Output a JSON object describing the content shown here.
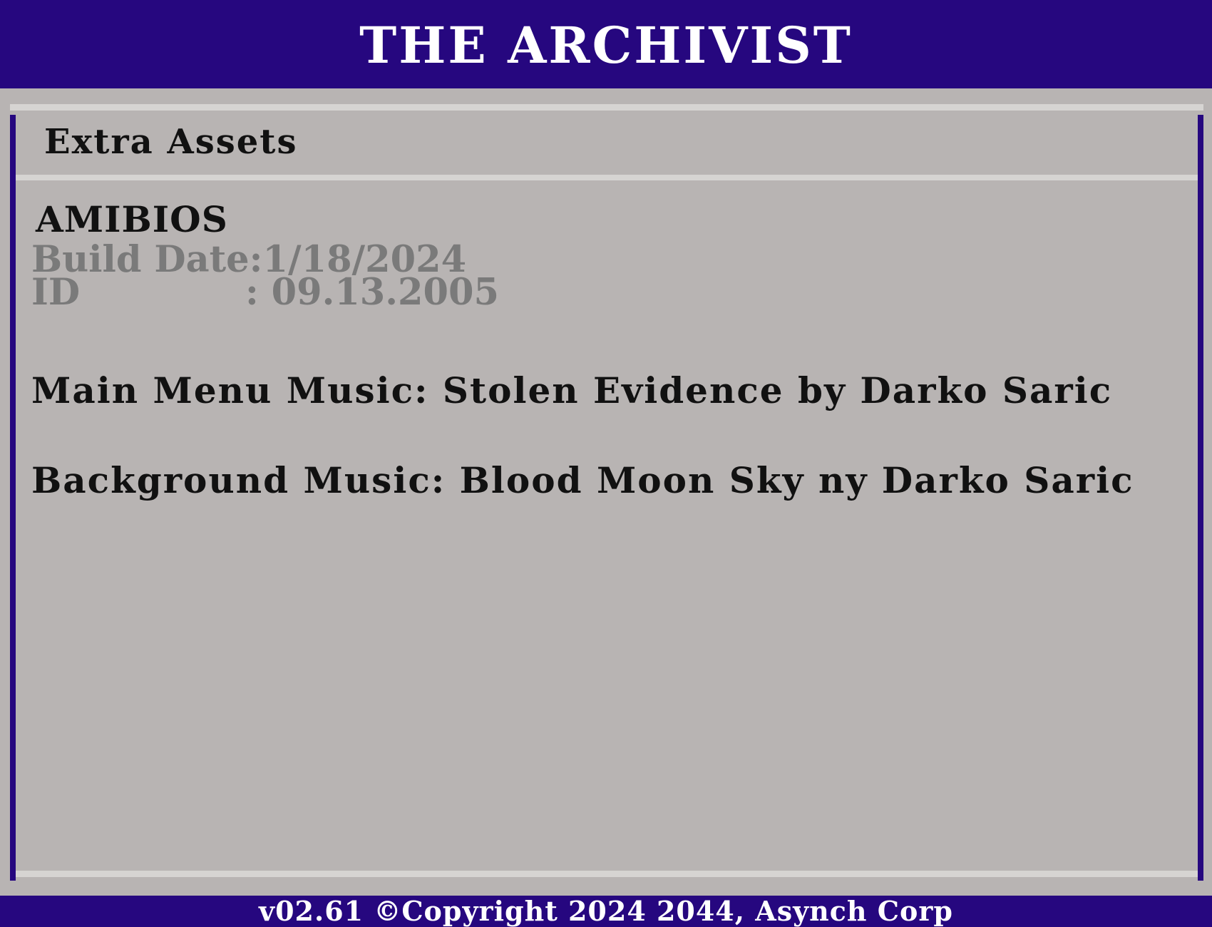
{
  "app": {
    "title": "THE ARCHIVIST"
  },
  "panel": {
    "title": "Extra Assets"
  },
  "bios": {
    "name": "AMIBIOS",
    "build_date_label": "Build Date",
    "build_date_sep": ":",
    "build_date_value": "1/18/2024",
    "id_label": "ID",
    "id_sep": ": ",
    "id_value": "09.13.2005"
  },
  "credits": [
    "Main Menu Music: Stolen Evidence by Darko Saric",
    "Background Music: Blood Moon Sky ny Darko Saric"
  ],
  "footer": {
    "text": "v02.61 ©Copyright 2024 2044, Asynch Corp"
  },
  "colors": {
    "bar_background": "#26077f",
    "panel_background": "#b8b4b3",
    "panel_border": "#d6d4d2",
    "muted_text": "#7a7a7a",
    "main_text": "#111111"
  }
}
